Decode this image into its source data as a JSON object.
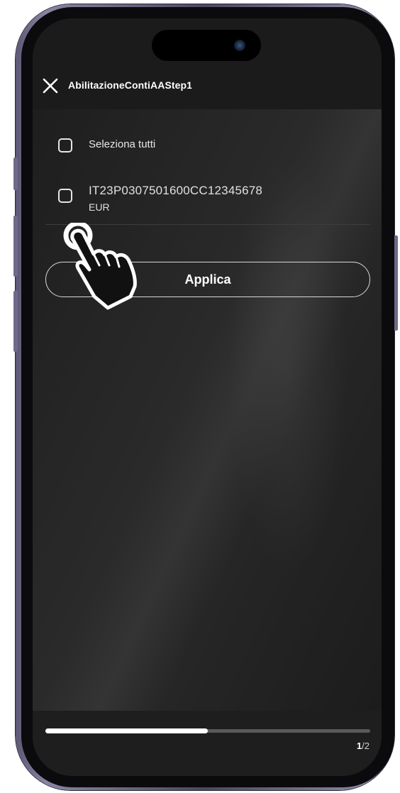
{
  "header": {
    "title": "AbilitazioneContiAAStep1",
    "close_icon": "close-icon"
  },
  "select_all": {
    "label": "Seleziona tutti",
    "checked": false
  },
  "accounts": [
    {
      "iban": "IT23P0307501600CC12345678",
      "currency": "EUR",
      "checked": false
    }
  ],
  "apply_button": {
    "label": "Applica"
  },
  "tap_hint_icon": "tap-hand-icon",
  "progress": {
    "fraction": 0.5,
    "current": "1",
    "separator": "/",
    "total": "2"
  },
  "colors": {
    "background": "#1e1e1e",
    "text": "#ffffff",
    "progress_fill": "#ffffff",
    "progress_track": "#5a5a5a"
  }
}
